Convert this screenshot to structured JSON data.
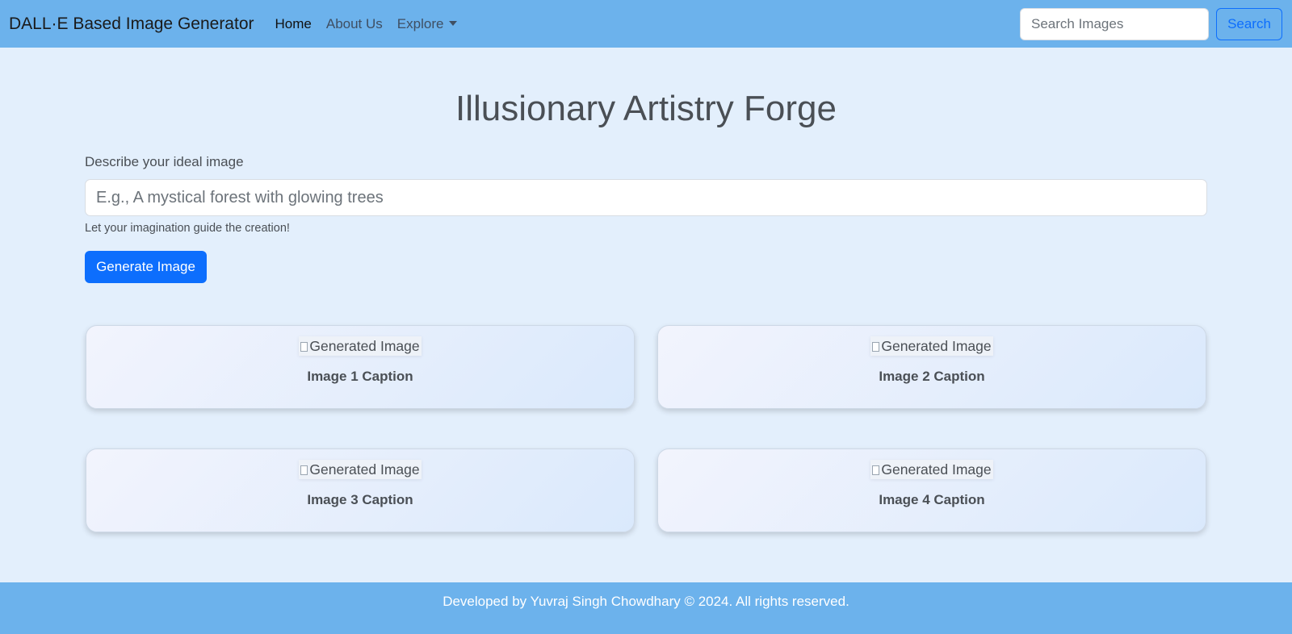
{
  "navbar": {
    "brand": "DALL·E Based Image Generator",
    "links": [
      "Home",
      "About Us",
      "Explore"
    ],
    "search_placeholder": "Search Images",
    "search_button": "Search"
  },
  "main": {
    "title": "Illusionary Artistry Forge",
    "prompt_label": "Describe your ideal image",
    "prompt_placeholder": "E.g., A mystical forest with glowing trees",
    "help_text": "Let your imagination guide the creation!",
    "generate_button": "Generate Image"
  },
  "gallery": [
    {
      "alt": "Generated Image",
      "caption": "Image 1 Caption"
    },
    {
      "alt": "Generated Image",
      "caption": "Image 2 Caption"
    },
    {
      "alt": "Generated Image",
      "caption": "Image 3 Caption"
    },
    {
      "alt": "Generated Image",
      "caption": "Image 4 Caption"
    }
  ],
  "footer": {
    "text": "Developed by Yuvraj Singh Chowdhary © 2024. All rights reserved."
  },
  "colors": {
    "navbar": "#6cb2ec",
    "background": "#e3effc",
    "primary": "#0d6efd"
  }
}
